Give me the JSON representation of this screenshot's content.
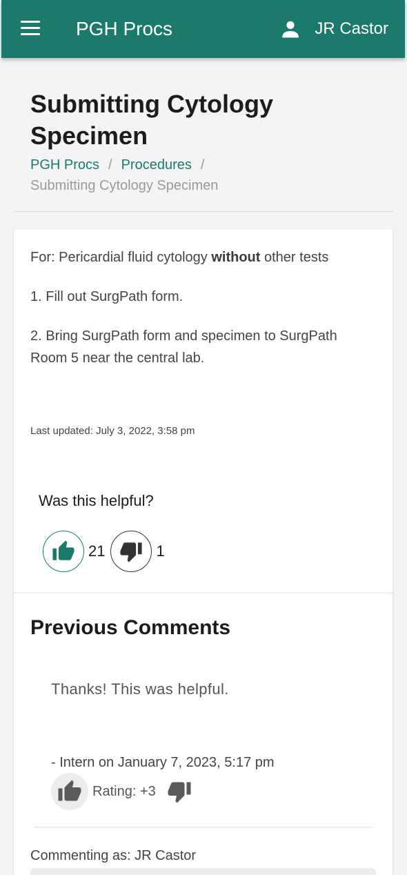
{
  "appbar": {
    "title": "PGH Procs",
    "user_name": "JR Castor"
  },
  "page": {
    "title": "Submitting Cytology Specimen",
    "breadcrumb": {
      "home": "PGH Procs",
      "section": "Procedures",
      "separator": "/",
      "current": "Submitting Cytology Specimen"
    }
  },
  "content": {
    "for_prefix": "For: Pericardial fluid cytology",
    "for_bold": "without",
    "for_suffix": "other tests",
    "step1": "1. Fill out SurgPath form.",
    "step2": "2. Bring SurgPath form and specimen to SurgPath Room 5 near the central lab.",
    "last_updated": "Last updated: July 3, 2022, 3:58 pm"
  },
  "feedback": {
    "question": "Was this helpful?",
    "thumbs_up_count": "21",
    "thumbs_down_count": "1"
  },
  "comments": {
    "title": "Previous Comments",
    "items": [
      {
        "text": "Thanks! This was helpful.",
        "meta": "- Intern on January 7, 2023, 5:17 pm",
        "rating": "Rating: +3"
      }
    ],
    "commenting_as": "Commenting as: JR Castor"
  },
  "colors": {
    "accent": "#1b7a6b",
    "background": "#f4f4f4",
    "card": "#ffffff"
  }
}
